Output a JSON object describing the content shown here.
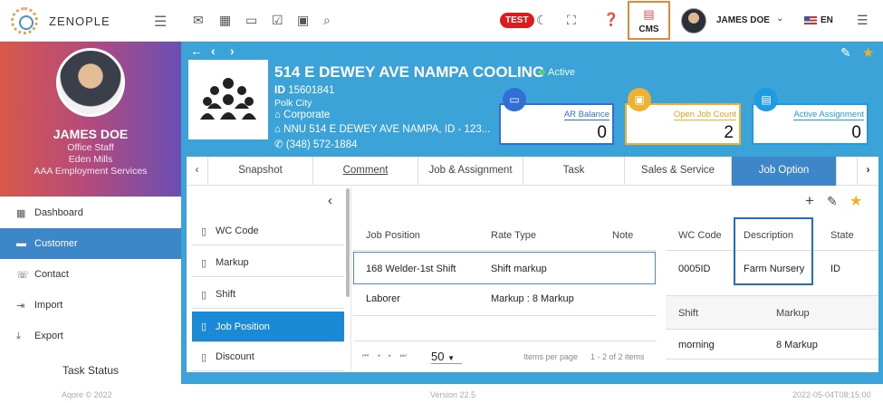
{
  "app": {
    "logo_text": "ZENOPLE"
  },
  "topbar": {
    "test_badge": "TEST",
    "cms_label": "CMS",
    "user_name": "JAMES DOE",
    "language": "EN"
  },
  "profile": {
    "name": "JAMES DOE",
    "role": "Office Staff",
    "location": "Eden Mills",
    "company": "AAA Employment Services"
  },
  "sidebar": {
    "items": [
      {
        "label": "Dashboard",
        "icon": "dashboard-icon"
      },
      {
        "label": "Customer",
        "icon": "customer-icon",
        "active": true
      },
      {
        "label": "Contact",
        "icon": "contact-icon"
      },
      {
        "label": "Import",
        "icon": "import-icon"
      },
      {
        "label": "Export",
        "icon": "export-icon"
      }
    ],
    "task_status": "Task Status"
  },
  "customer": {
    "name": "514 E DEWEY AVE NAMPA COOLING",
    "status": "Active",
    "id_label": "ID",
    "id": "15601841",
    "city": "Polk City",
    "type": "Corporate",
    "address": "NNU 514 E DEWEY AVE NAMPA, ID - 123...",
    "phone": "(348) 572-1884"
  },
  "cards": [
    {
      "label": "AR Balance",
      "value": "0",
      "color": "#2f6fd6"
    },
    {
      "label": "Open Job Count",
      "value": "2",
      "color": "#f0b030"
    },
    {
      "label": "Active Assignment",
      "value": "0",
      "color": "#1f9be0"
    }
  ],
  "tabs": [
    "Snapshot",
    "Comment",
    "Job & Assignment",
    "Task",
    "Sales & Service",
    "Job Option"
  ],
  "options": {
    "items": [
      "WC Code",
      "Markup",
      "Shift",
      "Job Position",
      "Discount"
    ],
    "active": "Job Position"
  },
  "job_table": {
    "headers": [
      "Job Position",
      "Rate Type",
      "Note"
    ],
    "rows": [
      [
        "168 Welder-1st Shift",
        "Shift markup",
        ""
      ],
      [
        "Laborer",
        "Markup : 8 Markup",
        ""
      ]
    ],
    "page_size": "50",
    "items_per_page": "Items per page",
    "range": "1 - 2 of 2 items"
  },
  "wc_table": {
    "headers": [
      "WC Code",
      "Description",
      "State"
    ],
    "rows": [
      [
        "0005ID",
        "Farm Nursery",
        "ID"
      ]
    ]
  },
  "shift_table": {
    "headers": [
      "Shift",
      "Markup"
    ],
    "rows": [
      [
        "morning",
        "8 Markup"
      ]
    ]
  },
  "footer": {
    "copyright": "Aqore © 2022",
    "version": "Version 22.5",
    "timestamp": "2022-05-04T08:15:00"
  }
}
